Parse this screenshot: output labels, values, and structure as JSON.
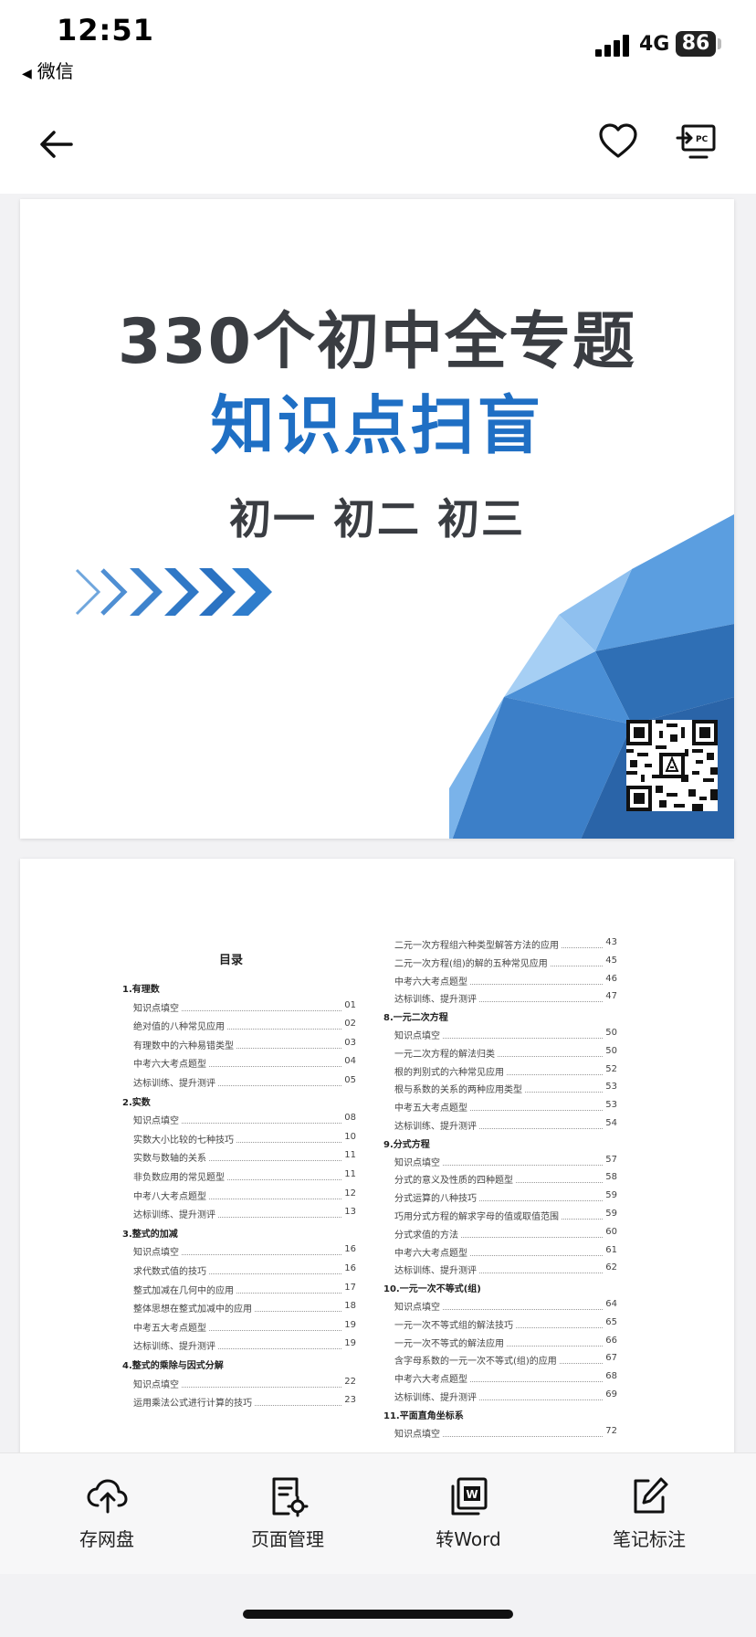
{
  "status_bar": {
    "time": "12:51",
    "back_app": "微信",
    "network": "4G",
    "battery": "86"
  },
  "nav": {
    "back_icon": "arrow-left-icon",
    "favorite_icon": "heart-icon",
    "pc_icon": "send-to-pc-icon",
    "pc_badge": "PC"
  },
  "page1": {
    "title_line1": "330个初中全专题",
    "title_line2": "知识点扫盲",
    "title_line3": "初一 初二 初三",
    "accent_color": "#1f6fc4"
  },
  "page2": {
    "toc_title": "目录",
    "left_column": [
      {
        "type": "head",
        "text": "1.有理数"
      },
      {
        "type": "item",
        "text": "知识点填空",
        "page": "01"
      },
      {
        "type": "item",
        "text": "绝对值的八种常见应用",
        "page": "02"
      },
      {
        "type": "item",
        "text": "有理数中的六种易错类型",
        "page": "03"
      },
      {
        "type": "item",
        "text": "中考六大考点题型",
        "page": "04"
      },
      {
        "type": "item",
        "text": "达标训练、提升测评",
        "page": "05"
      },
      {
        "type": "head",
        "text": "2.实数"
      },
      {
        "type": "item",
        "text": "知识点填空",
        "page": "08"
      },
      {
        "type": "item",
        "text": "实数大小比较的七种技巧",
        "page": "10"
      },
      {
        "type": "item",
        "text": "实数与数轴的关系",
        "page": "11"
      },
      {
        "type": "item",
        "text": "非负数应用的常见题型",
        "page": "11"
      },
      {
        "type": "item",
        "text": "中考八大考点题型",
        "page": "12"
      },
      {
        "type": "item",
        "text": "达标训练、提升测评",
        "page": "13"
      },
      {
        "type": "head",
        "text": "3.整式的加减"
      },
      {
        "type": "item",
        "text": "知识点填空",
        "page": "16"
      },
      {
        "type": "item",
        "text": "求代数式值的技巧",
        "page": "16"
      },
      {
        "type": "item",
        "text": "整式加减在几何中的应用",
        "page": "17"
      },
      {
        "type": "item",
        "text": "整体思想在整式加减中的应用",
        "page": "18"
      },
      {
        "type": "item",
        "text": "中考五大考点题型",
        "page": "19"
      },
      {
        "type": "item",
        "text": "达标训练、提升测评",
        "page": "19"
      },
      {
        "type": "head",
        "text": "4.整式的乘除与因式分解"
      },
      {
        "type": "item",
        "text": "知识点填空",
        "page": "22"
      },
      {
        "type": "item",
        "text": "运用乘法公式进行计算的技巧",
        "page": "23"
      }
    ],
    "right_column": [
      {
        "type": "item",
        "text": "二元一次方程组六种类型解答方法的应用",
        "page": "43"
      },
      {
        "type": "item",
        "text": "二元一次方程(组)的解的五种常见应用",
        "page": "45"
      },
      {
        "type": "item",
        "text": "中考六大考点题型",
        "page": "46"
      },
      {
        "type": "item",
        "text": "达标训练、提升测评",
        "page": "47"
      },
      {
        "type": "head",
        "text": "8.一元二次方程"
      },
      {
        "type": "item",
        "text": "知识点填空",
        "page": "50"
      },
      {
        "type": "item",
        "text": "一元二次方程的解法归类",
        "page": "50"
      },
      {
        "type": "item",
        "text": "根的判别式的六种常见应用",
        "page": "52"
      },
      {
        "type": "item",
        "text": "根与系数的关系的两种应用类型",
        "page": "53"
      },
      {
        "type": "item",
        "text": "中考五大考点题型",
        "page": "53"
      },
      {
        "type": "item",
        "text": "达标训练、提升测评",
        "page": "54"
      },
      {
        "type": "head",
        "text": "9.分式方程"
      },
      {
        "type": "item",
        "text": "知识点填空",
        "page": "57"
      },
      {
        "type": "item",
        "text": "分式的意义及性质的四种题型",
        "page": "58"
      },
      {
        "type": "item",
        "text": "分式运算的八种技巧",
        "page": "59"
      },
      {
        "type": "item",
        "text": "巧用分式方程的解求字母的值或取值范围",
        "page": "59"
      },
      {
        "type": "item",
        "text": "分式求值的方法",
        "page": "60"
      },
      {
        "type": "item",
        "text": "中考六大考点题型",
        "page": "61"
      },
      {
        "type": "item",
        "text": "达标训练、提升测评",
        "page": "62"
      },
      {
        "type": "head",
        "text": "10.一元一次不等式(组)"
      },
      {
        "type": "item",
        "text": "知识点填空",
        "page": "64"
      },
      {
        "type": "item",
        "text": "一元一次不等式组的解法技巧",
        "page": "65"
      },
      {
        "type": "item",
        "text": "一元一次不等式的解法应用",
        "page": "66"
      },
      {
        "type": "item",
        "text": "含字母系数的一元一次不等式(组)的应用",
        "page": "67"
      },
      {
        "type": "item",
        "text": "中考六大考点题型",
        "page": "68"
      },
      {
        "type": "item",
        "text": "达标训练、提升测评",
        "page": "69"
      },
      {
        "type": "head",
        "text": "11.平面直角坐标系"
      },
      {
        "type": "item",
        "text": "知识点填空",
        "page": "72"
      }
    ]
  },
  "toolbar": {
    "items": [
      {
        "label": "存网盘",
        "icon": "cloud-upload-icon"
      },
      {
        "label": "页面管理",
        "icon": "page-settings-icon"
      },
      {
        "label": "转Word",
        "icon": "word-convert-icon"
      },
      {
        "label": "笔记标注",
        "icon": "edit-note-icon"
      }
    ]
  }
}
